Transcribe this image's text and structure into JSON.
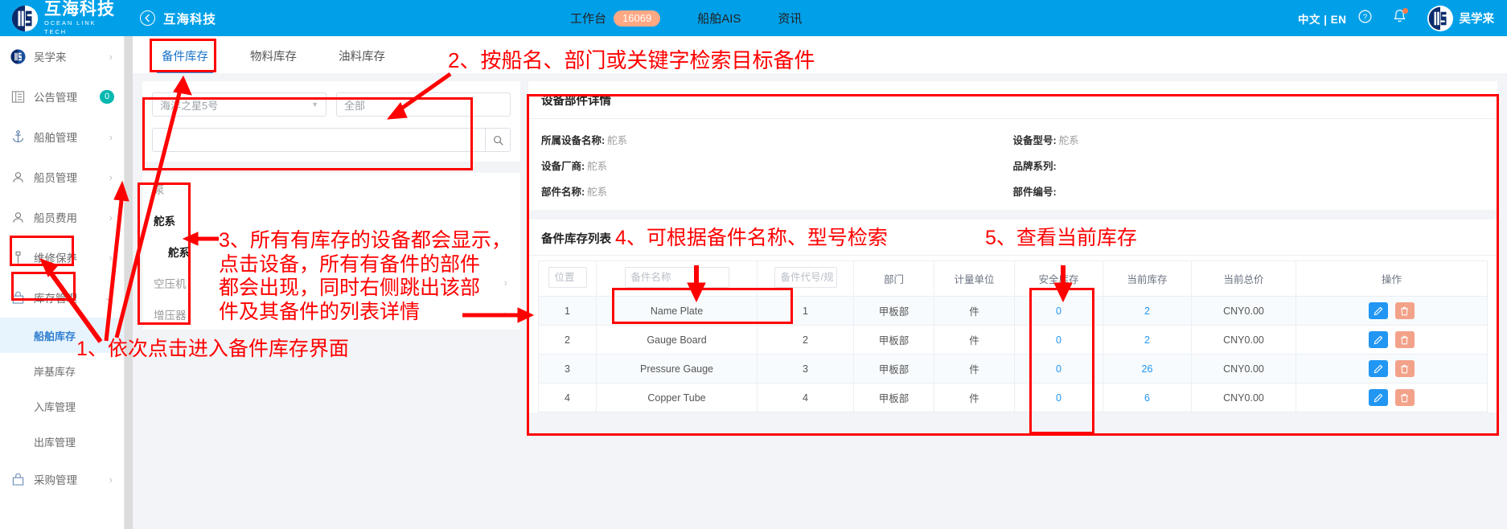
{
  "topbar": {
    "brand_cn": "互海科技",
    "brand_en": "OCEAN LINK TECH",
    "back_label": "互海科技",
    "nav": [
      {
        "label": "工作台",
        "badge": "16069"
      },
      {
        "label": "船舶AIS",
        "badge": ""
      },
      {
        "label": "资讯",
        "badge": ""
      }
    ],
    "lang": "中文 | EN",
    "user_name": "吴学来",
    "icons": {
      "back": "back-arrow-icon",
      "help": "help-icon",
      "bell": "bell-icon",
      "avatar": "avatar-icon"
    }
  },
  "sidebar": {
    "items": [
      {
        "label": "吴学来",
        "icon": "user-logo-icon",
        "chev": "›",
        "badge": ""
      },
      {
        "label": "公告管理",
        "icon": "announcement-icon",
        "chev": "",
        "badge": "0"
      },
      {
        "label": "船舶管理",
        "icon": "anchor-icon",
        "chev": "›",
        "badge": ""
      },
      {
        "label": "船员管理",
        "icon": "crew-icon",
        "chev": "›",
        "badge": ""
      },
      {
        "label": "船员费用",
        "icon": "crew-cost-icon",
        "chev": "›",
        "badge": ""
      },
      {
        "label": "维修保养",
        "icon": "maintenance-icon",
        "chev": "›",
        "badge": ""
      },
      {
        "label": "库存管理",
        "icon": "inventory-icon",
        "chev": "⌄",
        "badge": ""
      }
    ],
    "sub_items": [
      {
        "label": "船舶库存",
        "active": true
      },
      {
        "label": "岸基库存",
        "active": false
      },
      {
        "label": "入库管理",
        "active": false
      },
      {
        "label": "出库管理",
        "active": false
      }
    ],
    "items_after": [
      {
        "label": "采购管理",
        "icon": "purchase-icon",
        "chev": "›",
        "badge": ""
      }
    ]
  },
  "tabs": [
    {
      "label": "备件库存",
      "active": true
    },
    {
      "label": "物料库存",
      "active": false
    },
    {
      "label": "油料库存",
      "active": false
    }
  ],
  "filters": {
    "ship_value": "海洋之星5号",
    "dept_value": "全部",
    "keyword_value": "",
    "keyword_placeholder": "",
    "search_icon": "search-icon",
    "menu_icon": "list-toggle-icon"
  },
  "tree": [
    {
      "label": "泵",
      "level": 0,
      "dim": true,
      "chev": ""
    },
    {
      "label": "舵系",
      "level": 0,
      "dim": false,
      "chev": ""
    },
    {
      "label": "舵系",
      "level": 1,
      "dim": false,
      "chev": ""
    },
    {
      "label": "空压机",
      "level": 0,
      "dim": true,
      "chev": "›"
    },
    {
      "label": "增压器",
      "level": 0,
      "dim": true,
      "chev": "›"
    }
  ],
  "detail": {
    "title": "设备部件详情",
    "fields": [
      {
        "label": "所属设备名称:",
        "value": "舵系"
      },
      {
        "label": "设备型号:",
        "value": "舵系"
      },
      {
        "label": "设备厂商:",
        "value": "舵系"
      },
      {
        "label": "品牌系列:",
        "value": ""
      },
      {
        "label": "部件名称:",
        "value": "舵系"
      },
      {
        "label": "部件编号:",
        "value": ""
      }
    ]
  },
  "list": {
    "title": "备件库存列表",
    "columns": [
      "位置",
      "备件名称",
      "备件代号/规格",
      "部门",
      "计量单位",
      "安全库存",
      "当前库存",
      "当前总价",
      "操作"
    ],
    "header_inputs": {
      "pos": "位置",
      "name_placeholder": "备件名称",
      "code_placeholder": "备件代号/规"
    },
    "rows": [
      {
        "pos": "1",
        "name": "Name Plate",
        "code": "1",
        "dept": "甲板部",
        "unit": "件",
        "safe": "0",
        "current": "2",
        "price": "CNY0.00"
      },
      {
        "pos": "2",
        "name": "Gauge Board",
        "code": "2",
        "dept": "甲板部",
        "unit": "件",
        "safe": "0",
        "current": "2",
        "price": "CNY0.00"
      },
      {
        "pos": "3",
        "name": "Pressure Gauge",
        "code": "3",
        "dept": "甲板部",
        "unit": "件",
        "safe": "0",
        "current": "26",
        "price": "CNY0.00"
      },
      {
        "pos": "4",
        "name": "Copper Tube",
        "code": "4",
        "dept": "甲板部",
        "unit": "件",
        "safe": "0",
        "current": "6",
        "price": "CNY0.00"
      }
    ],
    "action_icons": {
      "edit": "edit-pencil-icon",
      "delete": "trash-icon"
    }
  },
  "annotations": [
    {
      "id": "a1",
      "text": "1、依次点击进入备件库存界面"
    },
    {
      "id": "a2",
      "text": "2、按船名、部门或关键字检索目标备件"
    },
    {
      "id": "a3",
      "text": "3、所有有库存的设备都会显示，\n点击设备，所有有备件的部件\n都会出现，同时右侧跳出该部\n件及其备件的列表详情"
    },
    {
      "id": "a4",
      "text": "4、可根据备件名称、型号检索"
    },
    {
      "id": "a5",
      "text": "5、查看当前库存"
    }
  ],
  "colors": {
    "brand_blue": "#00a0e9",
    "accent_blue": "#2196f3",
    "annotation_red": "#ff0000",
    "badge_orange": "#ffa884",
    "badge_teal": "#00b8b0"
  }
}
